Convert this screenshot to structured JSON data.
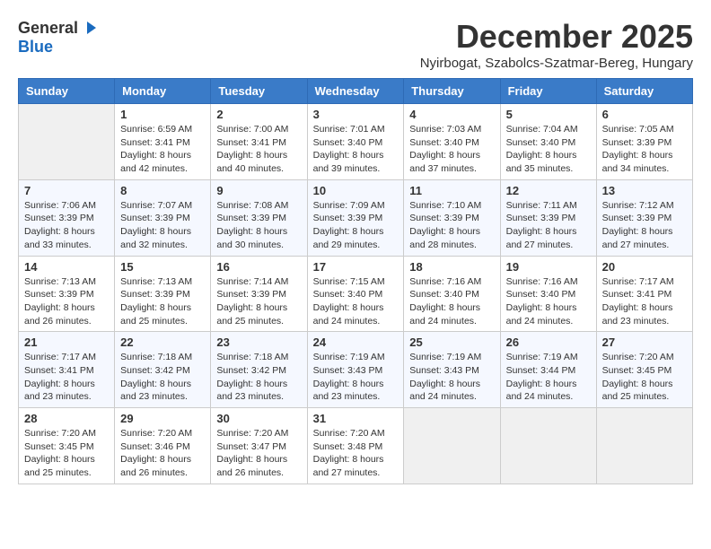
{
  "logo": {
    "general": "General",
    "blue": "Blue"
  },
  "title": "December 2025",
  "location": "Nyirbogat, Szabolcs-Szatmar-Bereg, Hungary",
  "weekdays": [
    "Sunday",
    "Monday",
    "Tuesday",
    "Wednesday",
    "Thursday",
    "Friday",
    "Saturday"
  ],
  "weeks": [
    [
      {
        "day": "",
        "info": ""
      },
      {
        "day": "1",
        "info": "Sunrise: 6:59 AM\nSunset: 3:41 PM\nDaylight: 8 hours\nand 42 minutes."
      },
      {
        "day": "2",
        "info": "Sunrise: 7:00 AM\nSunset: 3:41 PM\nDaylight: 8 hours\nand 40 minutes."
      },
      {
        "day": "3",
        "info": "Sunrise: 7:01 AM\nSunset: 3:40 PM\nDaylight: 8 hours\nand 39 minutes."
      },
      {
        "day": "4",
        "info": "Sunrise: 7:03 AM\nSunset: 3:40 PM\nDaylight: 8 hours\nand 37 minutes."
      },
      {
        "day": "5",
        "info": "Sunrise: 7:04 AM\nSunset: 3:40 PM\nDaylight: 8 hours\nand 35 minutes."
      },
      {
        "day": "6",
        "info": "Sunrise: 7:05 AM\nSunset: 3:39 PM\nDaylight: 8 hours\nand 34 minutes."
      }
    ],
    [
      {
        "day": "7",
        "info": "Sunrise: 7:06 AM\nSunset: 3:39 PM\nDaylight: 8 hours\nand 33 minutes."
      },
      {
        "day": "8",
        "info": "Sunrise: 7:07 AM\nSunset: 3:39 PM\nDaylight: 8 hours\nand 32 minutes."
      },
      {
        "day": "9",
        "info": "Sunrise: 7:08 AM\nSunset: 3:39 PM\nDaylight: 8 hours\nand 30 minutes."
      },
      {
        "day": "10",
        "info": "Sunrise: 7:09 AM\nSunset: 3:39 PM\nDaylight: 8 hours\nand 29 minutes."
      },
      {
        "day": "11",
        "info": "Sunrise: 7:10 AM\nSunset: 3:39 PM\nDaylight: 8 hours\nand 28 minutes."
      },
      {
        "day": "12",
        "info": "Sunrise: 7:11 AM\nSunset: 3:39 PM\nDaylight: 8 hours\nand 27 minutes."
      },
      {
        "day": "13",
        "info": "Sunrise: 7:12 AM\nSunset: 3:39 PM\nDaylight: 8 hours\nand 27 minutes."
      }
    ],
    [
      {
        "day": "14",
        "info": "Sunrise: 7:13 AM\nSunset: 3:39 PM\nDaylight: 8 hours\nand 26 minutes."
      },
      {
        "day": "15",
        "info": "Sunrise: 7:13 AM\nSunset: 3:39 PM\nDaylight: 8 hours\nand 25 minutes."
      },
      {
        "day": "16",
        "info": "Sunrise: 7:14 AM\nSunset: 3:39 PM\nDaylight: 8 hours\nand 25 minutes."
      },
      {
        "day": "17",
        "info": "Sunrise: 7:15 AM\nSunset: 3:40 PM\nDaylight: 8 hours\nand 24 minutes."
      },
      {
        "day": "18",
        "info": "Sunrise: 7:16 AM\nSunset: 3:40 PM\nDaylight: 8 hours\nand 24 minutes."
      },
      {
        "day": "19",
        "info": "Sunrise: 7:16 AM\nSunset: 3:40 PM\nDaylight: 8 hours\nand 24 minutes."
      },
      {
        "day": "20",
        "info": "Sunrise: 7:17 AM\nSunset: 3:41 PM\nDaylight: 8 hours\nand 23 minutes."
      }
    ],
    [
      {
        "day": "21",
        "info": "Sunrise: 7:17 AM\nSunset: 3:41 PM\nDaylight: 8 hours\nand 23 minutes."
      },
      {
        "day": "22",
        "info": "Sunrise: 7:18 AM\nSunset: 3:42 PM\nDaylight: 8 hours\nand 23 minutes."
      },
      {
        "day": "23",
        "info": "Sunrise: 7:18 AM\nSunset: 3:42 PM\nDaylight: 8 hours\nand 23 minutes."
      },
      {
        "day": "24",
        "info": "Sunrise: 7:19 AM\nSunset: 3:43 PM\nDaylight: 8 hours\nand 23 minutes."
      },
      {
        "day": "25",
        "info": "Sunrise: 7:19 AM\nSunset: 3:43 PM\nDaylight: 8 hours\nand 24 minutes."
      },
      {
        "day": "26",
        "info": "Sunrise: 7:19 AM\nSunset: 3:44 PM\nDaylight: 8 hours\nand 24 minutes."
      },
      {
        "day": "27",
        "info": "Sunrise: 7:20 AM\nSunset: 3:45 PM\nDaylight: 8 hours\nand 25 minutes."
      }
    ],
    [
      {
        "day": "28",
        "info": "Sunrise: 7:20 AM\nSunset: 3:45 PM\nDaylight: 8 hours\nand 25 minutes."
      },
      {
        "day": "29",
        "info": "Sunrise: 7:20 AM\nSunset: 3:46 PM\nDaylight: 8 hours\nand 26 minutes."
      },
      {
        "day": "30",
        "info": "Sunrise: 7:20 AM\nSunset: 3:47 PM\nDaylight: 8 hours\nand 26 minutes."
      },
      {
        "day": "31",
        "info": "Sunrise: 7:20 AM\nSunset: 3:48 PM\nDaylight: 8 hours\nand 27 minutes."
      },
      {
        "day": "",
        "info": ""
      },
      {
        "day": "",
        "info": ""
      },
      {
        "day": "",
        "info": ""
      }
    ]
  ]
}
